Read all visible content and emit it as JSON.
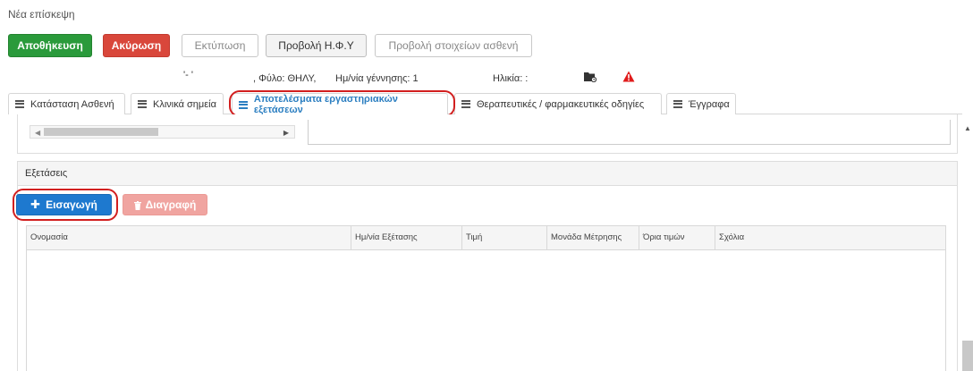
{
  "page": {
    "title": "Νέα επίσκεψη"
  },
  "toolbar": {
    "save_label": "Αποθήκευση",
    "cancel_label": "Ακύρωση",
    "print_label": "Εκτύπωση",
    "ehr_label": "Προβολή Η.Φ.Υ",
    "patient_info_label": "Προβολή στοιχείων ασθενή"
  },
  "patient": {
    "name_fragment": "'- '",
    "gender_text": ",  Φύλο: ΘΗΛΥ,",
    "dob_text": "Ημ/νία γέννησης: 1",
    "age_text": "Ηλικία: :",
    "icons": [
      "folder-icon",
      "warning-icon"
    ],
    "warning_color": "#e01b1b"
  },
  "tabs": [
    {
      "label": "Κατάσταση Ασθενή"
    },
    {
      "label": "Κλινικά σημεία"
    },
    {
      "label": "Αποτελέσματα εργαστηριακών εξετάσεων"
    },
    {
      "label": "Θεραπευτικές / φαρμακευτικές οδηγίες"
    },
    {
      "label": "Έγγραφα"
    }
  ],
  "exams": {
    "section_title": "Εξετάσεις",
    "insert_label": "Εισαγωγή",
    "delete_label": "Διαγραφή",
    "columns": [
      "Ονομασία",
      "Ημ/νία Εξέτασης",
      "Τιμή",
      "Μονάδα Μέτρησης",
      "Όρια τιμών",
      "Σχόλια"
    ],
    "rows": []
  },
  "colors": {
    "primary": "#1e79cf",
    "success": "#2a9a3b",
    "danger": "#d9473b",
    "highlight": "#d21f1f"
  }
}
